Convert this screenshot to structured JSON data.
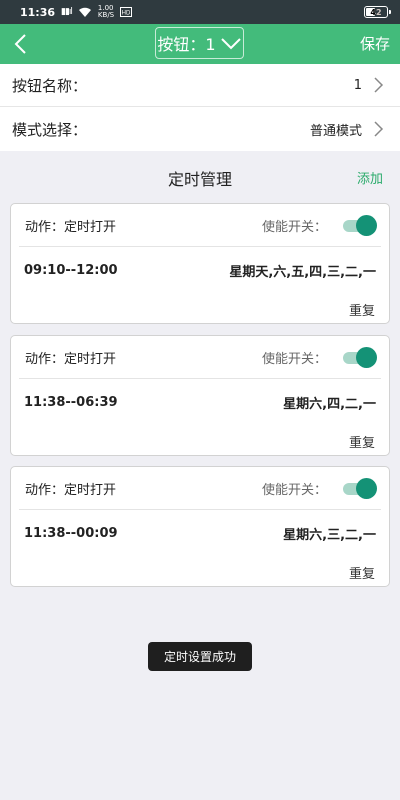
{
  "status_bar": {
    "time": "11:36",
    "signal": "▮▮ıl",
    "net_speed": "1.00",
    "net_unit": "KB/S",
    "battery": "42"
  },
  "header": {
    "selector_label": "按钮：1",
    "save_label": "保存"
  },
  "settings": {
    "button_name_label": "按钮名称：",
    "button_name_value": "1",
    "mode_label": "模式选择：",
    "mode_value": "普通模式"
  },
  "section": {
    "title": "定时管理",
    "add_label": "添加"
  },
  "timers": [
    {
      "action": "动作：定时打开",
      "enable_label": "使能开关：",
      "enabled": true,
      "time_range": "09:10--12:00",
      "days": "星期天,六,五,四,三,二,一",
      "repeat": "重复"
    },
    {
      "action": "动作：定时打开",
      "enable_label": "使能开关：",
      "enabled": true,
      "time_range": "11:38--06:39",
      "days": "星期六,四,二,一",
      "repeat": "重复"
    },
    {
      "action": "动作：定时打开",
      "enable_label": "使能开关：",
      "enabled": true,
      "time_range": "11:38--00:09",
      "days": "星期六,三,二,一",
      "repeat": "重复"
    }
  ],
  "toast": "定时设置成功",
  "colors": {
    "accent": "#43bb7b",
    "toggle_knob": "#149276",
    "add_link": "#2bab6b"
  }
}
